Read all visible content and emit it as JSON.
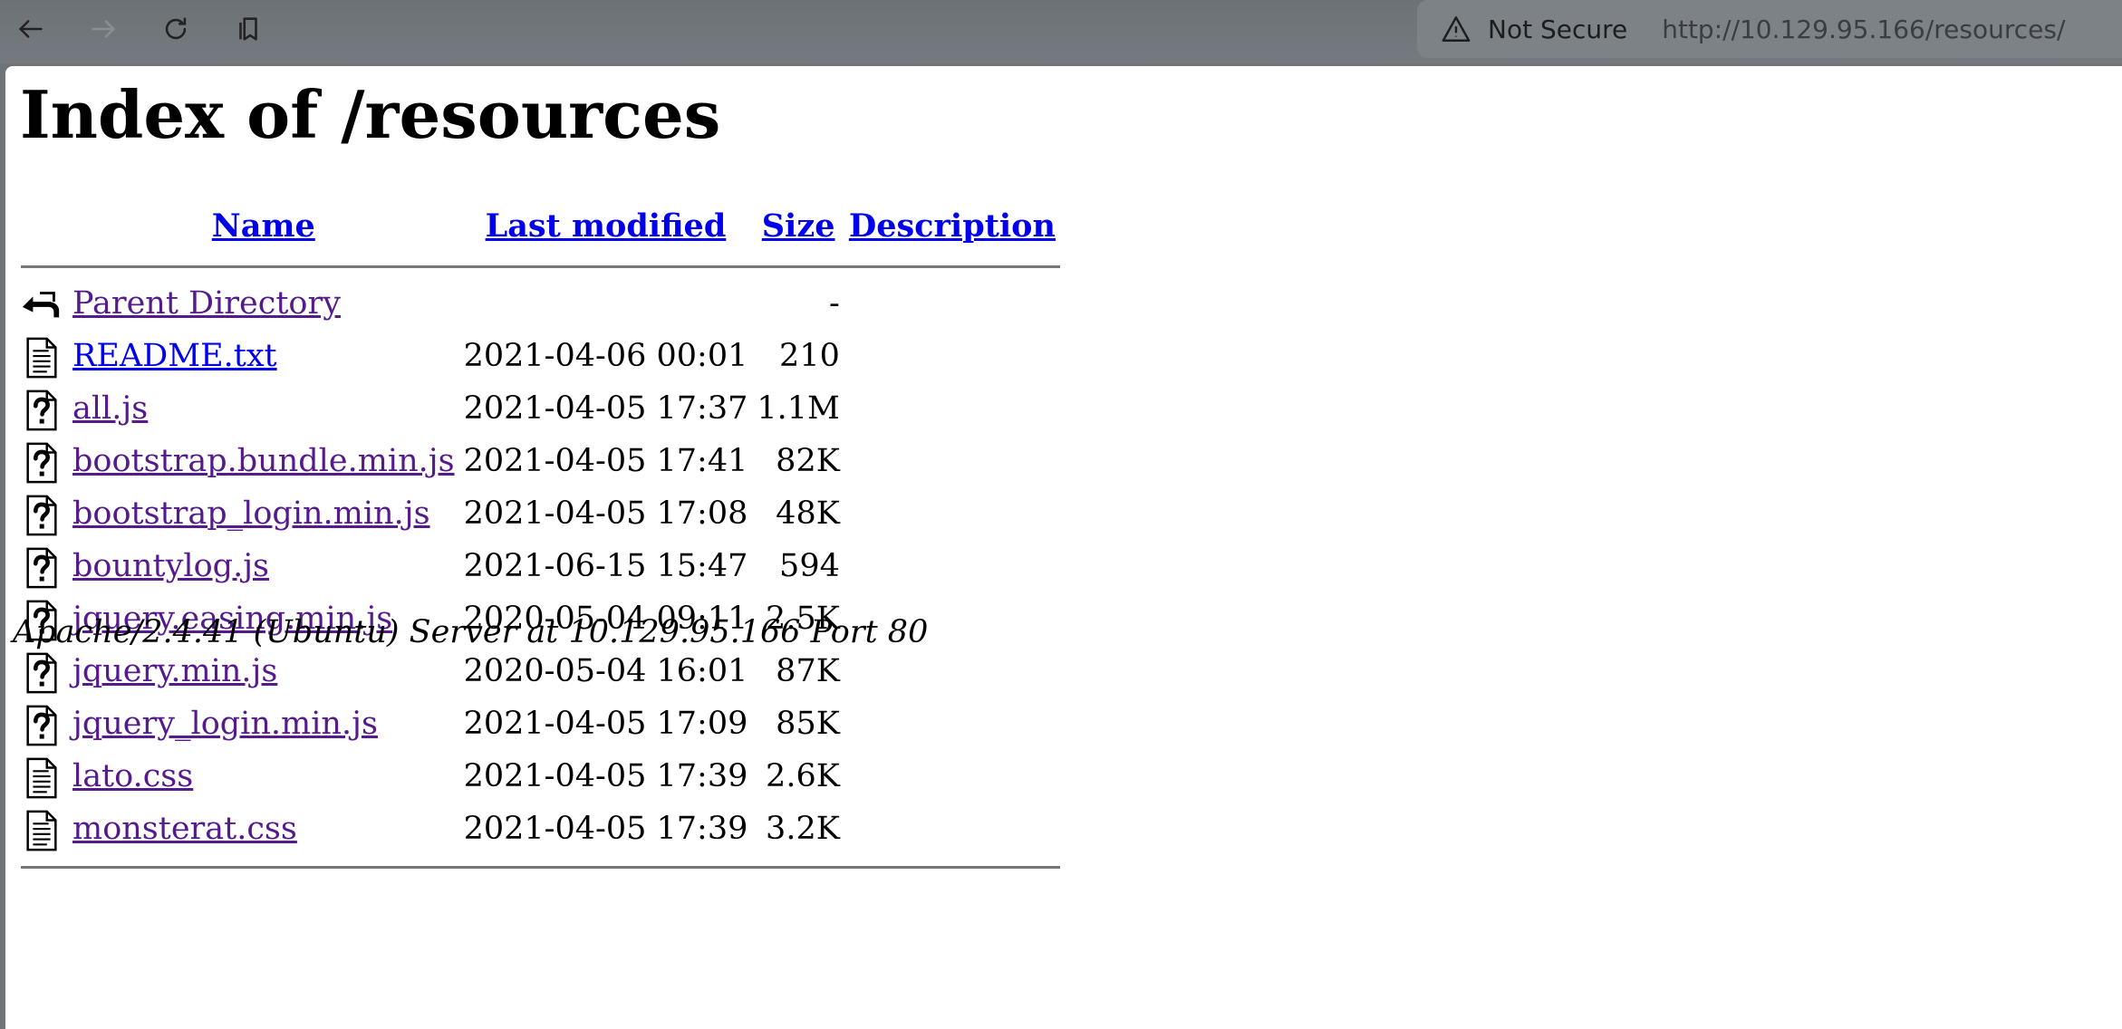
{
  "browser": {
    "security_label": "Not Secure",
    "url": "http://10.129.95.166/resources/"
  },
  "page": {
    "heading": "Index of /resources",
    "columns": {
      "name": "Name",
      "last_modified": "Last modified",
      "size": "Size",
      "description": "Description"
    },
    "parent": {
      "name": "Parent Directory",
      "size": "-"
    },
    "entries": [
      {
        "name": "README.txt",
        "modified": "2021-04-06 00:01",
        "size": "210",
        "icon": "text-file-icon"
      },
      {
        "name": "all.js",
        "modified": "2021-04-05 17:37",
        "size": "1.1M",
        "icon": "unknown-file-icon"
      },
      {
        "name": "bootstrap.bundle.min.js",
        "modified": "2021-04-05 17:41",
        "size": "82K",
        "icon": "unknown-file-icon"
      },
      {
        "name": "bootstrap_login.min.js",
        "modified": "2021-04-05 17:08",
        "size": "48K",
        "icon": "unknown-file-icon"
      },
      {
        "name": "bountylog.js",
        "modified": "2021-06-15 15:47",
        "size": "594",
        "icon": "unknown-file-icon"
      },
      {
        "name": "jquery.easing.min.js",
        "modified": "2020-05-04 09:11",
        "size": "2.5K",
        "icon": "unknown-file-icon"
      },
      {
        "name": "jquery.min.js",
        "modified": "2020-05-04 16:01",
        "size": "87K",
        "icon": "unknown-file-icon"
      },
      {
        "name": "jquery_login.min.js",
        "modified": "2021-04-05 17:09",
        "size": "85K",
        "icon": "unknown-file-icon"
      },
      {
        "name": "lato.css",
        "modified": "2021-04-05 17:39",
        "size": "2.6K",
        "icon": "text-file-icon"
      },
      {
        "name": "monsterat.css",
        "modified": "2021-04-05 17:39",
        "size": "3.2K",
        "icon": "text-file-icon"
      }
    ],
    "footer": "Apache/2.4.41 (Ubuntu) Server at 10.129.95.166 Port 80"
  }
}
